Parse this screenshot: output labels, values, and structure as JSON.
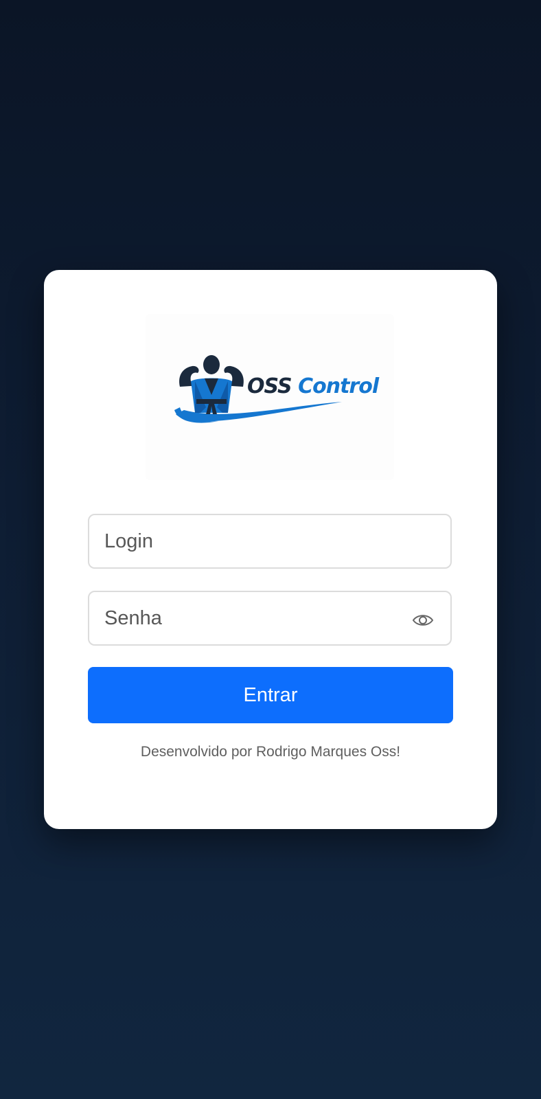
{
  "logo": {
    "word1": "OSS",
    "word2": "Control",
    "colors": {
      "dark": "#1b2a3d",
      "blue": "#1577d0"
    }
  },
  "form": {
    "login_placeholder": "Login",
    "password_placeholder": "Senha",
    "password_toggle_icon": "eye-icon",
    "submit_label": "Entrar"
  },
  "footer": {
    "credit": "Desenvolvido por Rodrigo Marques Oss!"
  },
  "colors": {
    "primary": "#0d6efd",
    "background_top": "#0b1526",
    "background_bottom": "#11263f",
    "card": "#ffffff"
  }
}
